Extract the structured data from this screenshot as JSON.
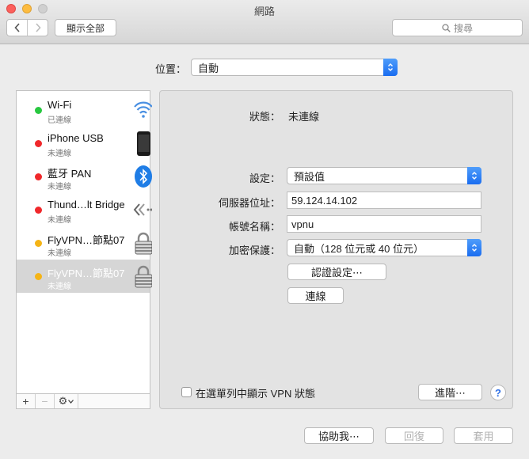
{
  "window": {
    "title": "網路"
  },
  "toolbar": {
    "back_label": "‹",
    "forward_label": "›",
    "show_all_label": "顯示全部",
    "search_placeholder": "搜尋"
  },
  "location": {
    "label": "位置：",
    "value": "自動"
  },
  "services": [
    {
      "name": "Wi-Fi",
      "status": "已連線",
      "dot_color": "#28c840",
      "icon": "wifi-icon"
    },
    {
      "name": "iPhone USB",
      "status": "未連線",
      "dot_color": "#f0282b",
      "icon": "iphone-icon"
    },
    {
      "name": "藍牙 PAN",
      "status": "未連線",
      "dot_color": "#f0282b",
      "icon": "bluetooth-icon"
    },
    {
      "name": "Thund…lt Bridge",
      "status": "未連線",
      "dot_color": "#f0282b",
      "icon": "thunderbolt-bridge-icon"
    },
    {
      "name": "FlyVPN…節點07",
      "status": "未連線",
      "dot_color": "#f5b416",
      "icon": "lock-icon"
    },
    {
      "name": "FlyVPN…節點07",
      "status": "未連線",
      "dot_color": "#f5b416",
      "icon": "lock-icon",
      "selected": true
    }
  ],
  "sidebar_buttons": {
    "add": "+",
    "remove": "−",
    "gear": "⚙"
  },
  "detail": {
    "status_label": "狀態：",
    "status_value": "未連線",
    "config_label": "設定：",
    "config_value": "預設值",
    "server_label": "伺服器位址：",
    "server_value": "59.124.14.102",
    "account_label": "帳號名稱：",
    "account_value": "vpnu",
    "encryption_label": "加密保護：",
    "encryption_value": "自動（128 位元或 40 位元）",
    "auth_button": "認證設定⋯",
    "connect_button": "連線",
    "show_vpn_label": "在選單列中顯示 VPN 狀態",
    "advanced_button": "進階⋯",
    "help_label": "?"
  },
  "footer": {
    "assist_button": "協助我⋯",
    "revert_button": "回復",
    "apply_button": "套用"
  },
  "colors": {
    "accent": "#1a6df0",
    "selected_row": "#d6d6d6"
  }
}
